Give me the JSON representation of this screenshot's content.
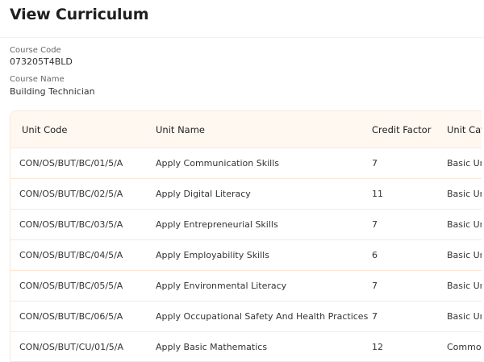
{
  "header": {
    "title": "View Curriculum"
  },
  "course": {
    "code_label": "Course Code",
    "code": "073205T4BLD",
    "name_label": "Course Name",
    "name": "Building Technician"
  },
  "table": {
    "columns": [
      "Unit Code",
      "Unit Name",
      "Credit Factor",
      "Unit Category"
    ],
    "rows": [
      [
        "CON/OS/BUT/BC/01/5/A",
        "Apply Communication Skills",
        "7",
        "Basic Unit"
      ],
      [
        "CON/OS/BUT/BC/02/5/A",
        "Apply Digital Literacy",
        "11",
        "Basic Unit"
      ],
      [
        "CON/OS/BUT/BC/03/5/A",
        "Apply Entrepreneurial Skills",
        "7",
        "Basic Unit"
      ],
      [
        "CON/OS/BUT/BC/04/5/A",
        "Apply Employability Skills",
        "6",
        "Basic Unit"
      ],
      [
        "CON/OS/BUT/BC/05/5/A",
        "Apply Environmental Literacy",
        "7",
        "Basic Unit"
      ],
      [
        "CON/OS/BUT/BC/06/5/A",
        "Apply Occupational Safety And Health Practices",
        "7",
        "Basic Unit"
      ],
      [
        "CON/OS/BUT/CU/01/5/A",
        "Apply Basic Mathematics",
        "12",
        "Common Unit"
      ]
    ]
  }
}
